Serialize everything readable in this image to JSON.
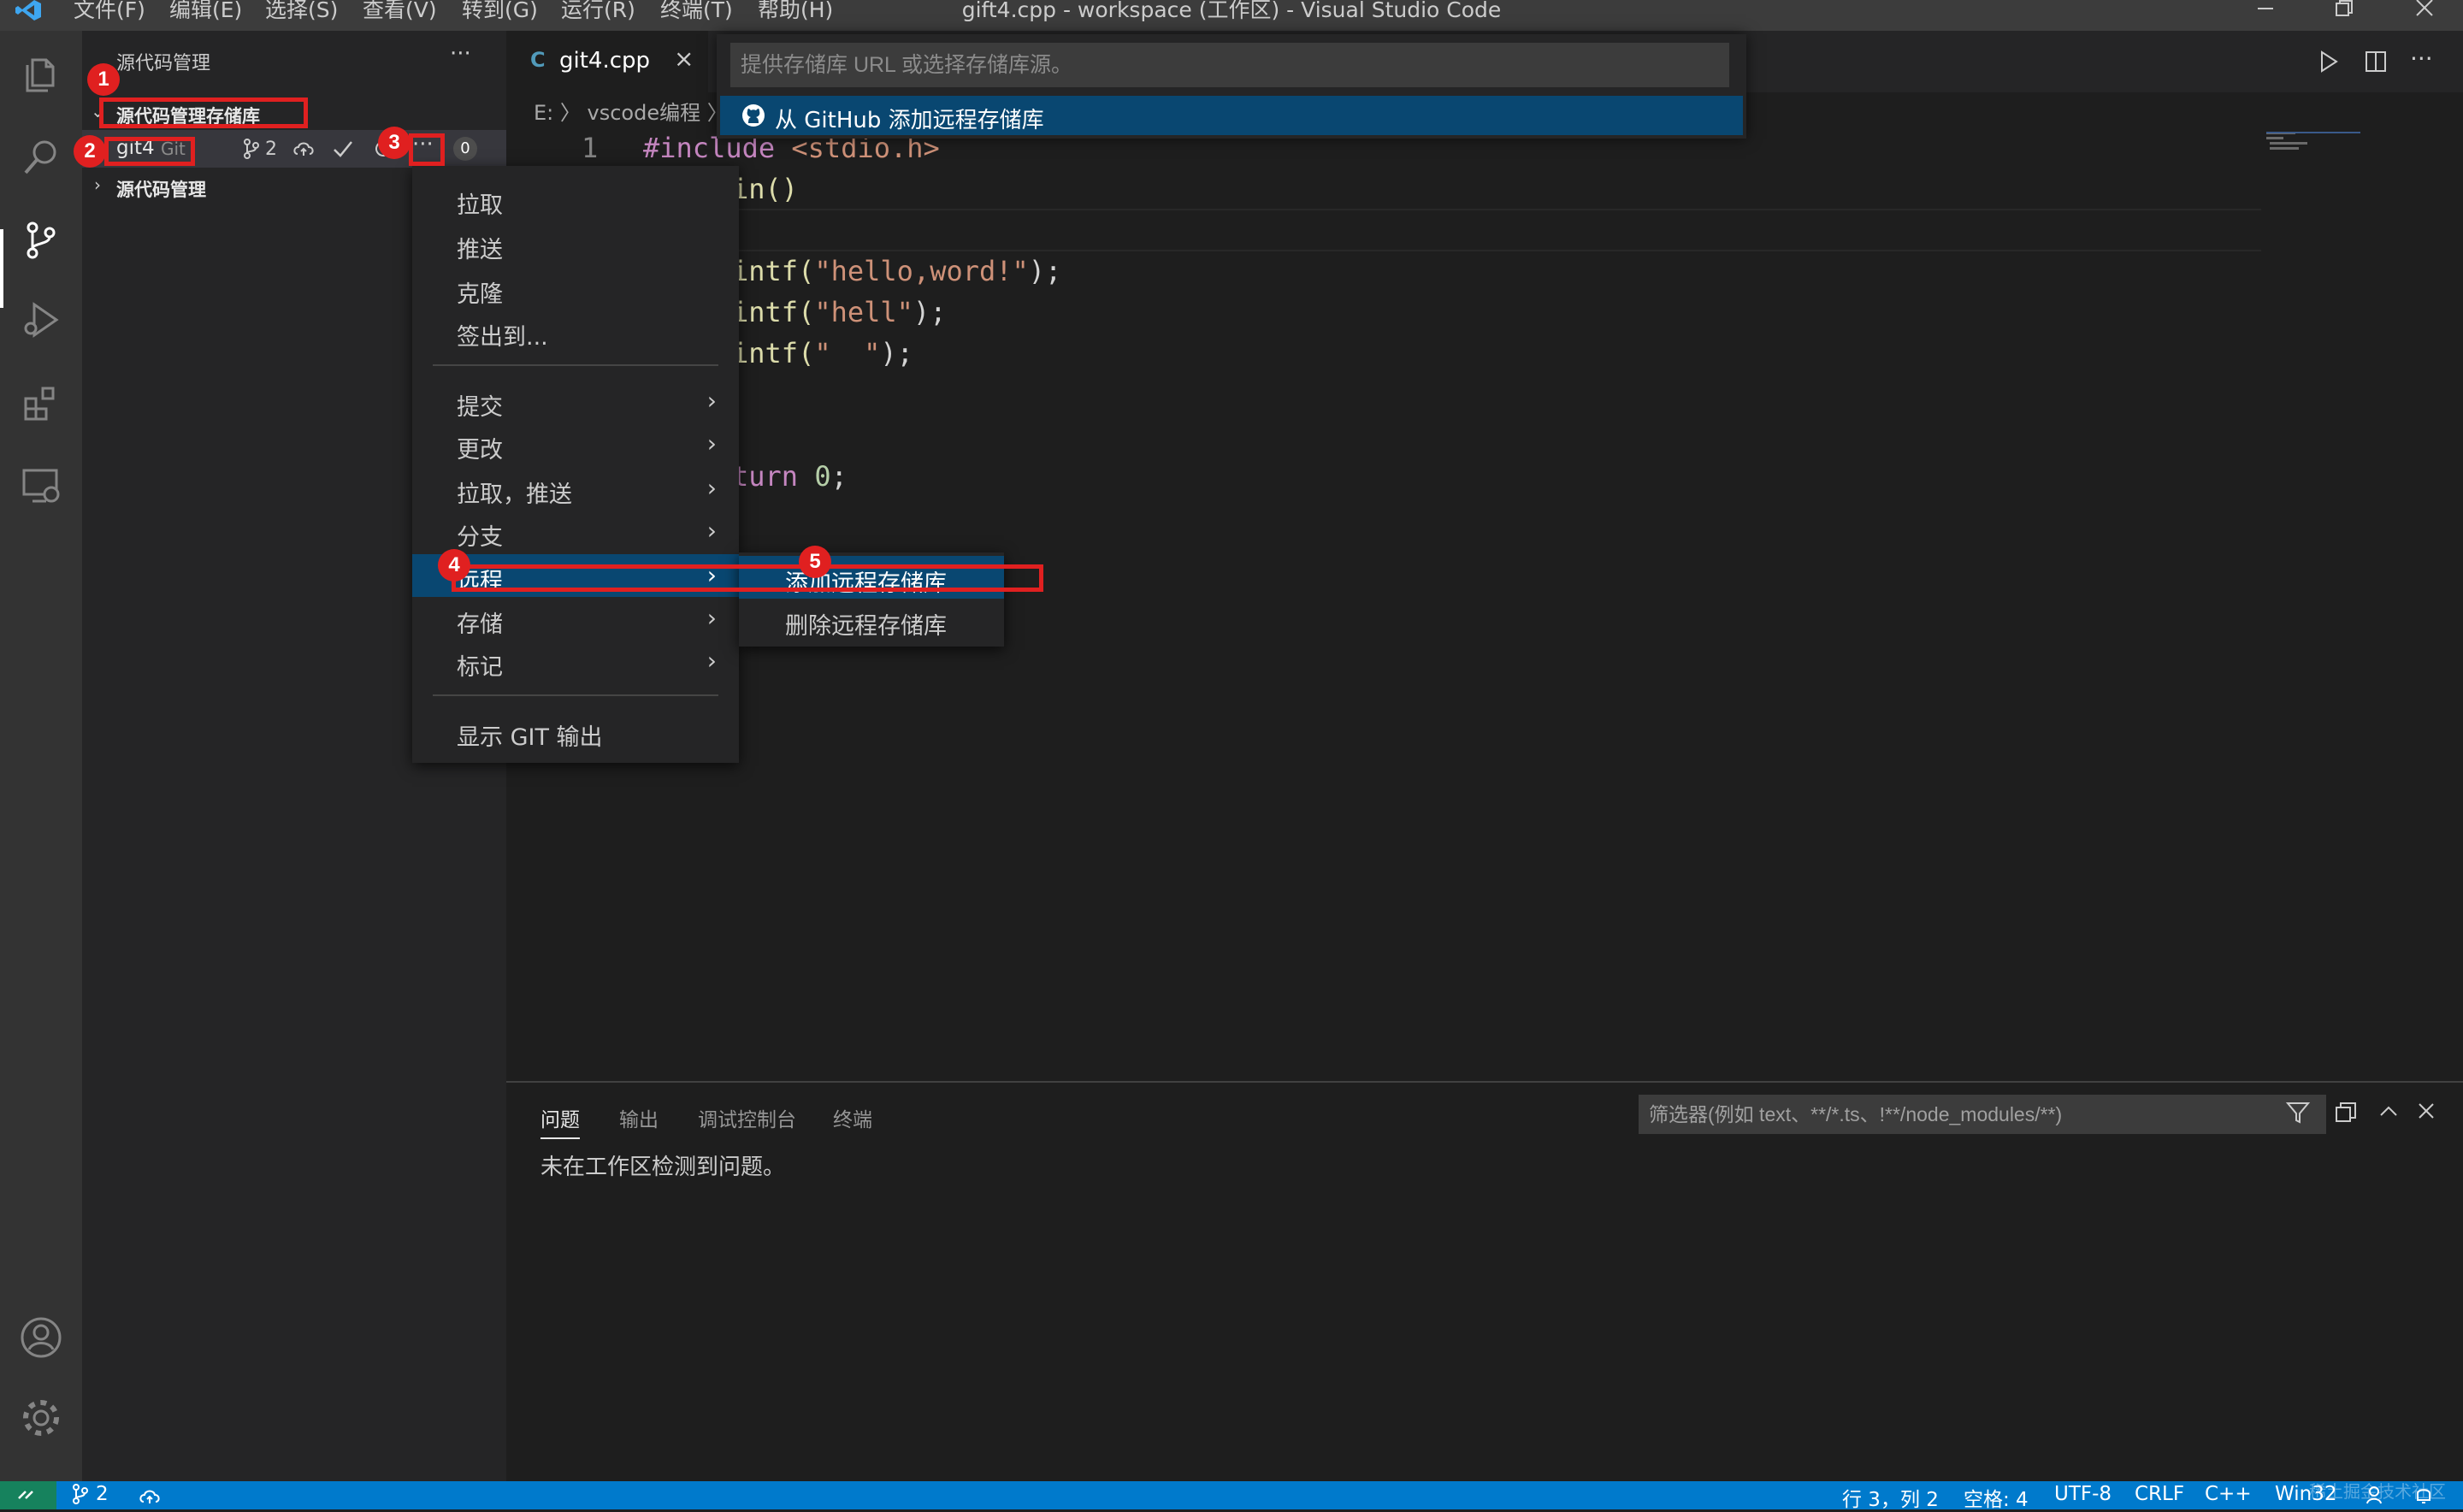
{
  "window": {
    "title": "gift4.cpp - workspace (工作区) - Visual Studio Code",
    "menu": [
      "文件(F)",
      "编辑(E)",
      "选择(S)",
      "查看(V)",
      "转到(G)",
      "运行(R)",
      "终端(T)",
      "帮助(H)"
    ]
  },
  "sidebar": {
    "title": "源代码管理",
    "more": "···",
    "section_repos": "源代码管理存储库",
    "repo": {
      "name": "git4",
      "type": "Git",
      "branch_count": "2",
      "badge": "0"
    },
    "section_scm": "源代码管理"
  },
  "editor": {
    "tab_label": "git4.cpp",
    "breadcrumb": "E: 〉 vscode编程 〉",
    "line_number": "1",
    "lines": {
      "l1_pp": "#include",
      "l1_hdr": "<stdio.h>",
      "l2": "in()",
      "l4_fn": "intf(",
      "l4_str": "\"hello,word!\"",
      "l4_end": ");",
      "l5_fn": "intf(",
      "l5_str": "\"hell\"",
      "l5_end": ");",
      "l6_fn": "intf(",
      "l6_str": "\"  \"",
      "l6_end": ");",
      "l9_kw": "turn",
      "l9_num": "0",
      "l9_end": ";"
    }
  },
  "quick_input": {
    "placeholder": "提供存储库 URL 或选择存储库源。",
    "item": "从 GitHub 添加远程存储库"
  },
  "context_menu": {
    "items": [
      "拉取",
      "推送",
      "克隆",
      "签出到..."
    ],
    "submenus": [
      "提交",
      "更改",
      "拉取，推送",
      "分支",
      "远程",
      "存储",
      "标记"
    ],
    "show_output": "显示 GIT 输出"
  },
  "remote_submenu": {
    "items": [
      "添加远程存储库...",
      "删除远程存储库"
    ]
  },
  "panel": {
    "tabs": [
      "问题",
      "输出",
      "调试控制台",
      "终端"
    ],
    "filter_placeholder": "筛选器(例如 text、**/*.ts、!**/node_modules/**)",
    "message": "未在工作区检测到问题。"
  },
  "statusbar": {
    "branches": "2",
    "position": "行 3，列 2",
    "spaces": "空格: 4",
    "encoding": "UTF-8",
    "eol": "CRLF",
    "language": "C++",
    "platform": "Win32"
  },
  "annotations": [
    "1",
    "2",
    "3",
    "4",
    "5"
  ],
  "watermark": "稀土掘金技术社区",
  "colors": {
    "activity_bar": "#333333",
    "sidebar": "#252526",
    "editor": "#1e1e1e",
    "statusbar": "#007acc",
    "selection": "#094771",
    "annotation": "#e02020"
  }
}
